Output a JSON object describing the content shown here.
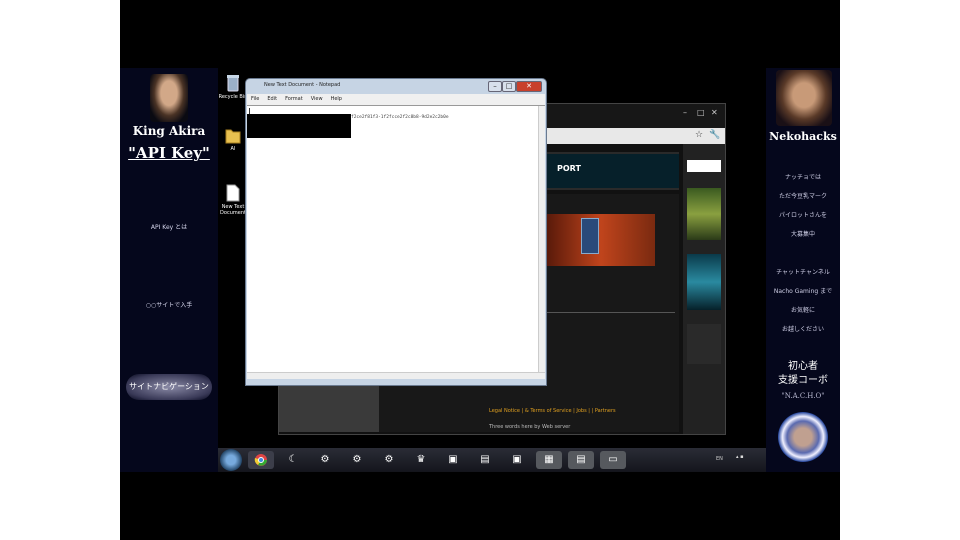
{
  "left_panel": {
    "name": "King Akira",
    "api_key": "\"API Key\"",
    "link_1": "API Key とは",
    "link_2": "○○サイトで入手",
    "nav_button": "サイトナビゲーション"
  },
  "right_panel": {
    "name": "Nekohacks",
    "lines": [
      "ナッチョでは",
      "ただ今豆乳マーク",
      "パイロットさんを",
      "大募集中",
      "",
      "チャットチャンネル",
      "Nacho Gaming まで",
      "お気軽に",
      "お越しください"
    ],
    "support_line_1": "初心者",
    "support_line_2": "支援コーボ",
    "nacho": "\"N.A.C.H.O\""
  },
  "desktop": {
    "icons": [
      {
        "label": "Recycle Bin",
        "icon": "recycle-bin-icon"
      },
      {
        "label": "AI",
        "icon": "folder-icon"
      },
      {
        "label": "New Text Document",
        "icon": "text-document-icon"
      }
    ]
  },
  "notepad": {
    "title": "New Text Document - Notepad",
    "menu": [
      "File",
      "Edit",
      "Format",
      "View",
      "Help"
    ],
    "key_fragment": "f2ce2f81f3-1f2fcce2f2c8b8-9d2e2c2b0e",
    "controls": {
      "minimize": "–",
      "maximize": "□",
      "close": "✕"
    }
  },
  "browser": {
    "controls": {
      "minimize": "–",
      "maximize": "□",
      "close": "✕"
    },
    "banner_text": "PORT",
    "footer_links": "Legal Notice | & Terms of Service | Jobs | | Partners",
    "footer_fine": "Three words here by Web server"
  },
  "taskbar": {
    "tray_text": "EN",
    "clock": "▴ ▪"
  },
  "colors": {
    "panel_bg": "#05071c",
    "notepad_close": "#c8402c",
    "browser_link": "#e0a020"
  }
}
